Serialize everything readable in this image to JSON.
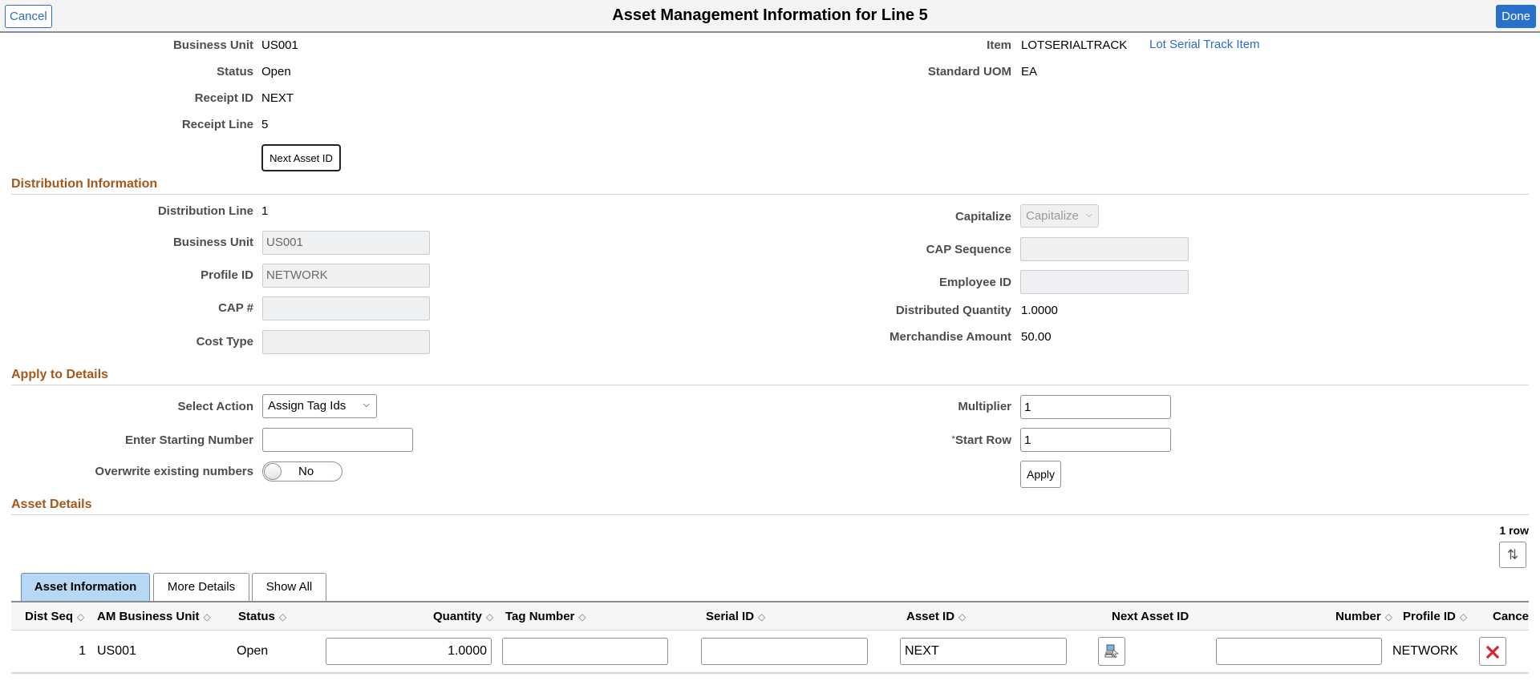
{
  "header": {
    "title": "Asset Management Information for Line 5",
    "cancel_label": "Cancel",
    "done_label": "Done"
  },
  "receipt": {
    "business_unit": {
      "label": "Business Unit",
      "value": "US001"
    },
    "status": {
      "label": "Status",
      "value": "Open"
    },
    "receipt_id": {
      "label": "Receipt ID",
      "value": "NEXT"
    },
    "receipt_line": {
      "label": "Receipt Line",
      "value": "5"
    },
    "item": {
      "label": "Item",
      "value": "LOTSERIALTRACK",
      "description": "Lot Serial Track Item"
    },
    "standard_uom": {
      "label": "Standard UOM",
      "value": "EA"
    },
    "next_asset_id_button": "Next Asset ID"
  },
  "distribution": {
    "heading": "Distribution Information",
    "distribution_line": {
      "label": "Distribution Line",
      "value": "1"
    },
    "business_unit": {
      "label": "Business Unit",
      "value": "US001"
    },
    "profile_id": {
      "label": "Profile ID",
      "value": "NETWORK"
    },
    "cap_number": {
      "label": "CAP #",
      "value": ""
    },
    "cost_type": {
      "label": "Cost Type",
      "value": ""
    },
    "capitalize": {
      "label": "Capitalize",
      "value": "Capitalize"
    },
    "cap_sequence": {
      "label": "CAP Sequence",
      "value": ""
    },
    "employee_id": {
      "label": "Employee ID",
      "value": ""
    },
    "distributed_quantity": {
      "label": "Distributed Quantity",
      "value": "1.0000"
    },
    "merchandise_amount": {
      "label": "Merchandise Amount",
      "value": "50.00"
    }
  },
  "apply": {
    "heading": "Apply to Details",
    "select_action": {
      "label": "Select Action",
      "value": "Assign Tag Ids"
    },
    "starting_number": {
      "label": "Enter Starting Number",
      "value": ""
    },
    "overwrite": {
      "label": "Overwrite existing numbers",
      "value": "No"
    },
    "multiplier": {
      "label": "Multiplier",
      "value": "1"
    },
    "start_row": {
      "label": "Start Row",
      "required_mark": "*",
      "value": "1"
    },
    "apply_button": "Apply"
  },
  "asset_details": {
    "heading": "Asset Details",
    "row_count": "1 row",
    "tabs": [
      {
        "label": "Asset Information",
        "active": true
      },
      {
        "label": "More Details",
        "active": false
      },
      {
        "label": "Show All",
        "active": false
      }
    ],
    "columns": [
      "Dist Seq",
      "AM Business Unit",
      "Status",
      "Quantity",
      "Tag Number",
      "Serial ID",
      "Asset ID",
      "Next Asset ID",
      "Number",
      "Profile ID",
      "Cancel"
    ],
    "sort_icon": "◇",
    "rows": [
      {
        "dist_seq": "1",
        "am_business_unit": "US001",
        "status": "Open",
        "quantity": "1.0000",
        "tag_number": "",
        "serial_id": "",
        "asset_id": "NEXT",
        "number": "",
        "profile_id": "NETWORK"
      }
    ]
  },
  "colors": {
    "accent_blue": "#2970cc",
    "section_heading": "#a5571a",
    "active_tab": "#b7d8f5",
    "cancel_x": "#d9262c"
  }
}
